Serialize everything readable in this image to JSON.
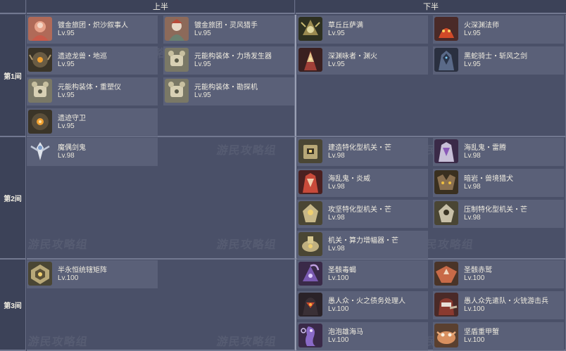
{
  "headers": {
    "top_half": "上半",
    "bottom_half": "下半"
  },
  "rows": [
    {
      "label": "第1间",
      "top": [
        {
          "name": "镀金旅团・炽沙叙事人",
          "level": "Lv.95",
          "icon": "sand-storyteller-portrait"
        },
        {
          "name": "镀金旅团・灵风猎手",
          "level": "Lv.95",
          "icon": "wind-hunter-portrait"
        },
        {
          "name": "遗迹龙兽・地巡",
          "level": "Lv.95",
          "icon": "ruin-drake-portrait"
        },
        {
          "name": "元能构装体・力场发生器",
          "level": "Lv.95",
          "icon": "force-field-portrait"
        },
        {
          "name": "元能构装体・重塑仪",
          "level": "Lv.95",
          "icon": "refiner-portrait"
        },
        {
          "name": "元能构装体・勘探机",
          "level": "Lv.95",
          "icon": "prospector-portrait"
        },
        {
          "name": "遗迹守卫",
          "level": "Lv.95",
          "icon": "ruin-guard-portrait"
        }
      ],
      "bottom": [
        {
          "name": "草丘丘萨满",
          "level": "Lv.95",
          "icon": "dendro-shaman-portrait"
        },
        {
          "name": "火深渊法师",
          "level": "Lv.95",
          "icon": "pyro-abyss-mage-portrait"
        },
        {
          "name": "深渊咏者・渊火",
          "level": "Lv.95",
          "icon": "abyss-lector-portrait"
        },
        {
          "name": "黑蛇骑士・斩风之剑",
          "level": "Lv.95",
          "icon": "black-serpent-knight-portrait"
        }
      ]
    },
    {
      "label": "第2间",
      "top": [
        {
          "name": "魔偶剑鬼",
          "level": "Lv.98",
          "icon": "maguu-kenki-portrait"
        }
      ],
      "bottom": [
        {
          "name": "建造特化型机关・芒",
          "level": "Lv.98",
          "icon": "construction-machine-portrait"
        },
        {
          "name": "海乱鬼・雷腾",
          "level": "Lv.98",
          "icon": "kairagi-thunder-portrait"
        },
        {
          "name": "海乱鬼・炎威",
          "level": "Lv.98",
          "icon": "kairagi-fire-portrait"
        },
        {
          "name": "暗岩・兽境猎犬",
          "level": "Lv.98",
          "icon": "rifthound-portrait"
        },
        {
          "name": "攻坚特化型机关・芒",
          "level": "Lv.98",
          "icon": "assault-machine-portrait"
        },
        {
          "name": "压制特化型机关・芒",
          "level": "Lv.98",
          "icon": "suppression-machine-portrait"
        },
        {
          "name": "机关・算力增幅器・芒",
          "level": "Lv.98",
          "icon": "computing-amplifier-portrait"
        }
      ]
    },
    {
      "label": "第3间",
      "top": [
        {
          "name": "半永恒统辖矩阵",
          "level": "Lv.100",
          "icon": "aeonblight-matrix-portrait"
        }
      ],
      "bottom": [
        {
          "name": "圣骸毒蝎",
          "level": "Lv.100",
          "icon": "consecrated-scorpion-portrait"
        },
        {
          "name": "圣骸赤鹫",
          "level": "Lv.100",
          "icon": "consecrated-red-vulture-portrait"
        },
        {
          "name": "愚人众・火之债务处理人",
          "level": "Lv.100",
          "icon": "pyro-debt-collector-portrait"
        },
        {
          "name": "愚人众先遣队・火铳游击兵",
          "level": "Lv.100",
          "icon": "pyro-gunner-portrait"
        },
        {
          "name": "泡泡雄海马",
          "level": "Lv.100",
          "icon": "bubble-seahorse-portrait"
        },
        {
          "name": "坚盾重甲蟹",
          "level": "Lv.100",
          "icon": "shield-crab-portrait"
        }
      ]
    }
  ],
  "watermark": "游民攻略组",
  "colors": {
    "background": "#4a5068",
    "card": "#5a6078",
    "header": "#3c4258",
    "divider": "#727890",
    "text": "#f0ece0"
  }
}
